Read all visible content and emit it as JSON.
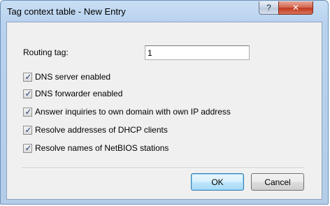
{
  "window": {
    "title": "Tag context table - New Entry",
    "help_glyph": "?",
    "close_glyph": "✕"
  },
  "form": {
    "routing_tag_label": "Routing tag:",
    "routing_tag_value": "1",
    "checkboxes": [
      {
        "label": "DNS server enabled",
        "checked": true
      },
      {
        "label": "DNS forwarder enabled",
        "checked": true
      },
      {
        "label": "Answer inquiries to own domain with own IP address",
        "checked": true
      },
      {
        "label": "Resolve addresses of DHCP clients",
        "checked": true
      },
      {
        "label": "Resolve names of NetBIOS stations",
        "checked": true
      }
    ],
    "check_glyph": "✓"
  },
  "buttons": {
    "ok_label": "OK",
    "cancel_label": "Cancel"
  }
}
